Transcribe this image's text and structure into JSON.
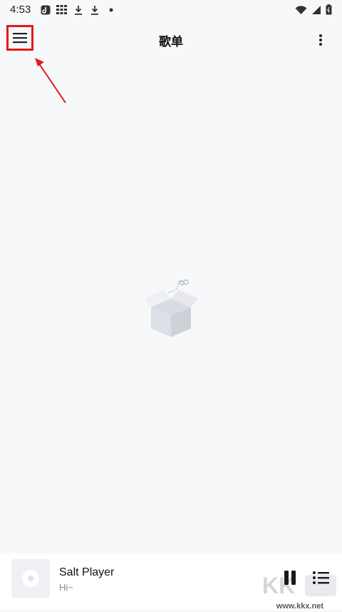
{
  "status": {
    "time": "4:53",
    "left_icons": [
      "app-icon",
      "grid-icon",
      "download-icon",
      "download-icon",
      "dot-icon"
    ],
    "right_icons": [
      "wifi-icon",
      "signal-icon",
      "battery-icon"
    ]
  },
  "appbar": {
    "title": "歌单",
    "menu_icon": "hamburger-menu-icon",
    "more_icon": "more-vert-icon"
  },
  "annotation": {
    "color": "#e01b1b"
  },
  "empty_state": {
    "icon": "empty-box-icon"
  },
  "player": {
    "title": "Salt Player",
    "subtitle": "Hi~",
    "art_icon": "disc-icon",
    "pause_icon": "pause-icon",
    "queue_icon": "queue-list-icon"
  },
  "watermark": {
    "url": "www.kkx.net"
  }
}
